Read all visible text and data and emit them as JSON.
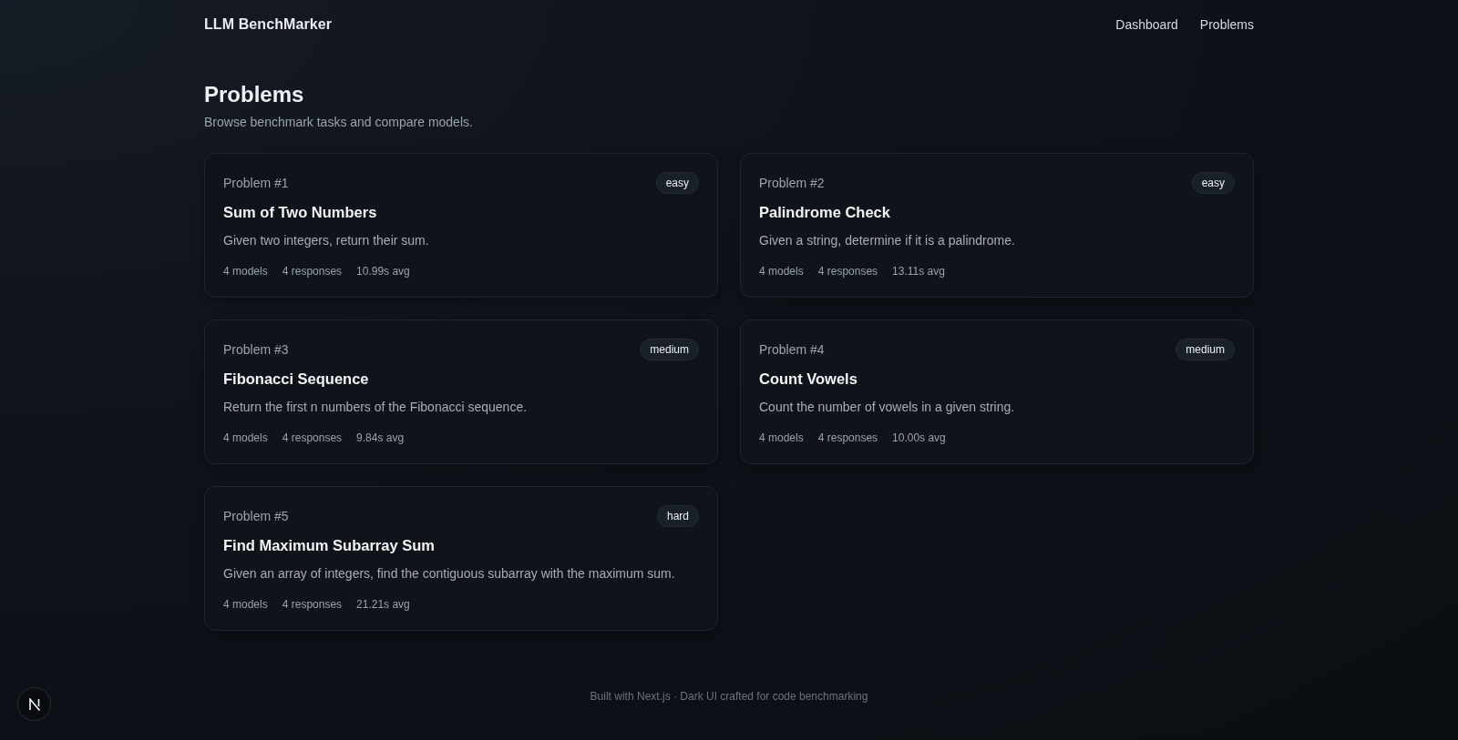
{
  "header": {
    "brand": "LLM BenchMarker",
    "nav": [
      {
        "label": "Dashboard"
      },
      {
        "label": "Problems"
      }
    ]
  },
  "page": {
    "title": "Problems",
    "subtitle": "Browse benchmark tasks and compare models."
  },
  "problems": [
    {
      "number": "Problem #1",
      "difficulty": "easy",
      "title": "Sum of Two Numbers",
      "description": "Given two integers, return their sum.",
      "stats": [
        "4 models",
        "4 responses",
        "10.99s avg"
      ]
    },
    {
      "number": "Problem #2",
      "difficulty": "easy",
      "title": "Palindrome Check",
      "description": "Given a string, determine if it is a palindrome.",
      "stats": [
        "4 models",
        "4 responses",
        "13.11s avg"
      ]
    },
    {
      "number": "Problem #3",
      "difficulty": "medium",
      "title": "Fibonacci Sequence",
      "description": "Return the first n numbers of the Fibonacci sequence.",
      "stats": [
        "4 models",
        "4 responses",
        "9.84s avg"
      ]
    },
    {
      "number": "Problem #4",
      "difficulty": "medium",
      "title": "Count Vowels",
      "description": "Count the number of vowels in a given string.",
      "stats": [
        "4 models",
        "4 responses",
        "10.00s avg"
      ]
    },
    {
      "number": "Problem #5",
      "difficulty": "hard",
      "title": "Find Maximum Subarray Sum",
      "description": "Given an array of integers, find the contiguous subarray with the maximum sum.",
      "stats": [
        "4 models",
        "4 responses",
        "21.21s avg"
      ]
    }
  ],
  "footer": {
    "text": "Built with Next.js · Dark UI crafted for code benchmarking"
  }
}
